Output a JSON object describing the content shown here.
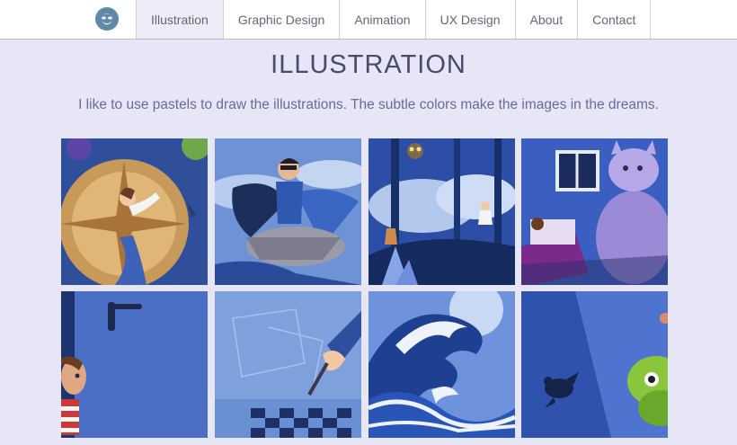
{
  "header": {
    "logo_icon": "bearded-face-logo-icon",
    "nav": [
      {
        "label": "Illustration",
        "active": true
      },
      {
        "label": "Graphic Design",
        "active": false
      },
      {
        "label": "Animation",
        "active": false
      },
      {
        "label": "UX Design",
        "active": false
      },
      {
        "label": "About",
        "active": false
      },
      {
        "label": "Contact",
        "active": false
      }
    ]
  },
  "main": {
    "title": "ILLUSTRATION",
    "intro": "I like to use pastels to draw the illustrations. The subtle colors make the images in the dreams."
  },
  "gallery": {
    "tiles": [
      {
        "subject": "girl-on-compass"
      },
      {
        "subject": "boy-riding-plane"
      },
      {
        "subject": "night-forest-deer-owl"
      },
      {
        "subject": "bedroom-with-cat"
      },
      {
        "subject": "child-behind-door"
      },
      {
        "subject": "hand-drawing-pencil"
      },
      {
        "subject": "great-wave"
      },
      {
        "subject": "turtle-and-frog"
      }
    ]
  },
  "colors": {
    "page_background": "#e6e6f7",
    "header_background": "#ffffff",
    "active_tab": "#ececf8",
    "text": "#5a5a8a"
  }
}
